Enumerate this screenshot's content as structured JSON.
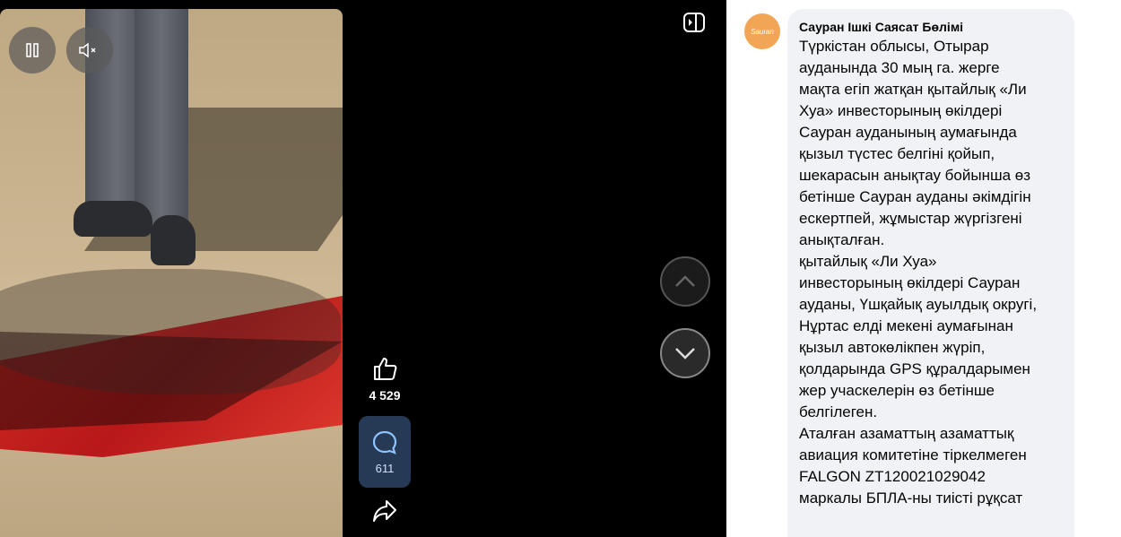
{
  "video": {
    "likes": "4 529",
    "comments": "611"
  },
  "post": {
    "author": "Сауран Ішкі Саясат Бөлімі",
    "avatar_text": "Sauran",
    "lines": [
      "Түркістан облысы, Отырар",
      "ауданында 30 мың га. жерге",
      "мақта егіп жатқан қытайлық «Ли",
      "Хуа» инвесторының өкілдері",
      "Сауран ауданының аумағында",
      "қызыл түстес белгіні қойып,",
      "шекарасын анықтау бойынша өз",
      "бетінше Сауран ауданы әкімдігін",
      "ескертпей, жұмыстар жүргізгені",
      "анықталған.",
      "қытайлық «Ли Хуа»",
      "инвесторының өкілдері Сауран",
      "ауданы, Үшқайық ауылдық округі,",
      "Нұртас елді мекені аумағынан",
      "қызыл автокөлікпен жүріп,",
      "қолдарында GPS құралдарымен",
      "жер учаскелерін өз бетінше",
      "белгілеген.",
      "Аталған азаматтың азаматтық",
      "авиация комитетіне тіркелмеген",
      "FALGON ZT120021029042",
      "маркалы БПЛА-ны тиісті рұқсат"
    ]
  },
  "colors": {
    "stage_bg": "#000000",
    "comment_bg": "#263a55",
    "bubble_bg": "#f0f2f5",
    "avatar": "#f3a556"
  }
}
